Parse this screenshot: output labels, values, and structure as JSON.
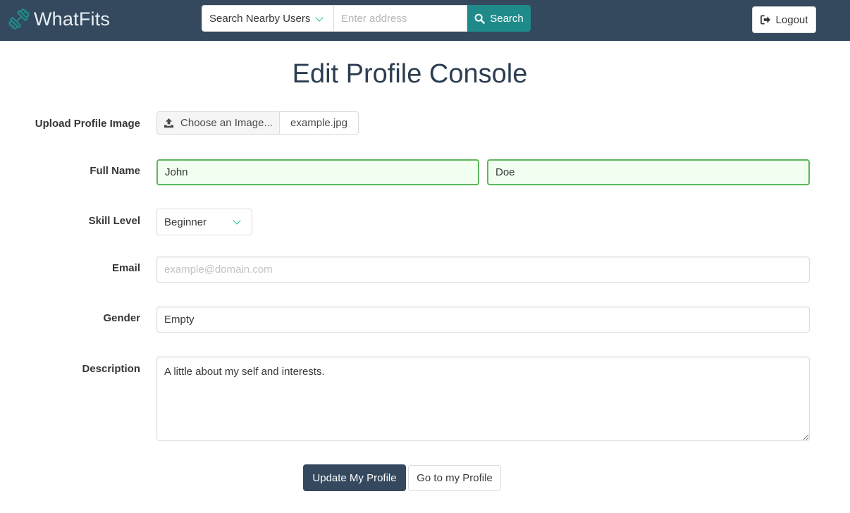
{
  "navbar": {
    "brand": "WhatFits",
    "search_type": "Search Nearby Users",
    "address_placeholder": "Enter address",
    "search_label": "Search",
    "logout_label": "Logout"
  },
  "page": {
    "title": "Edit Profile Console"
  },
  "form": {
    "upload_label": "Upload Profile Image",
    "choose_image_label": "Choose an Image...",
    "file_name": "example.jpg",
    "full_name_label": "Full Name",
    "first_name": "John",
    "last_name": "Doe",
    "skill_label": "Skill Level",
    "skill_value": "Beginner",
    "email_label": "Email",
    "email_placeholder": "example@domain.com",
    "gender_label": "Gender",
    "gender_value": "Empty",
    "description_label": "Description",
    "description_value": "A little about my self and interests.",
    "update_button": "Update My Profile",
    "profile_button": "Go to my Profile"
  },
  "colors": {
    "navbar": "#34495e",
    "accent": "#1f8a8a",
    "success_border": "#5cb85c",
    "success_bg": "#f0ffef"
  },
  "icons": {
    "brand": "dumbbell-icon",
    "search": "search-icon",
    "logout": "sign-out-icon",
    "upload": "upload-icon"
  }
}
